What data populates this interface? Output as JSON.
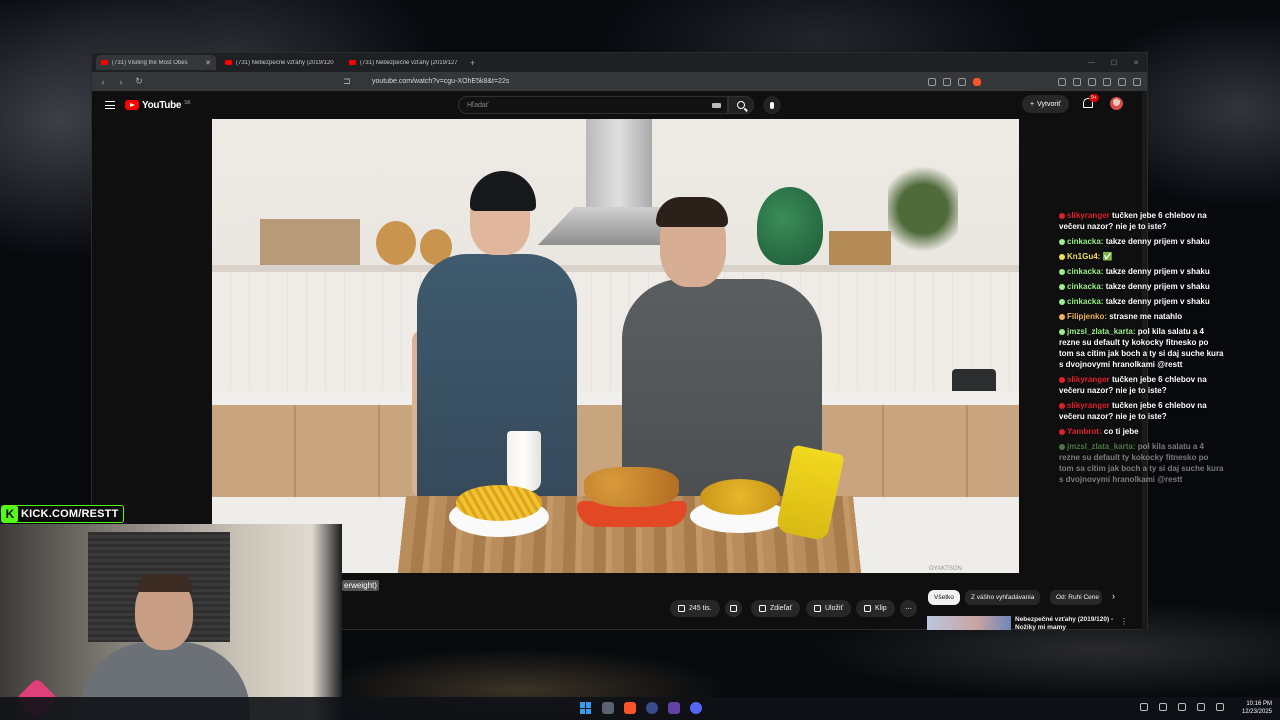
{
  "browser": {
    "tabs": [
      {
        "label": "(731) Visiting the Most Obes",
        "active": true
      },
      {
        "label": "(731) Nebezpečné vzťahy (2019/120",
        "active": false
      },
      {
        "label": "(731) Nebezpečné vzťahy (2019/127",
        "active": false
      }
    ],
    "url": "youtube.com/watch?v=cgu-XOhE5k8&t=22s"
  },
  "youtube": {
    "logo_text": "YouTube",
    "country_code": "SK",
    "search_placeholder": "Hľadať",
    "create_label": "Vytvoriť",
    "notification_count": "9+",
    "subtitle_chip": "erweight)",
    "like_count": "245 tis.",
    "share_label": "Zdieľať",
    "save_label": "Uložiť",
    "clip_label": "Klip",
    "filter_chips": [
      "Všetko",
      "Z vášho vyhľadávania",
      "Od: Ruhi Cene"
    ],
    "recommendation_title": "Nebezpečné vzťahy (2019/120) - Nožíky mi mamy",
    "video_watermark": "OYAKTSON"
  },
  "chat": {
    "messages": [
      {
        "user": "slikyranger",
        "color": "#e0202a",
        "text": "tučken jebe 6 chlebov na večeru nazor? nie je to iste?",
        "faded": false
      },
      {
        "user": "cinkacka:",
        "color": "#9af08a",
        "text": "takze denny prijem v shaku",
        "faded": false
      },
      {
        "user": "Kn1Gu4:",
        "color": "#f0e05a",
        "text": "✅",
        "faded": false
      },
      {
        "user": "cinkacka:",
        "color": "#9af08a",
        "text": "takze denny prijem v shaku",
        "faded": false
      },
      {
        "user": "cinkacka:",
        "color": "#9af08a",
        "text": "takze denny prijem v shaku",
        "faded": false
      },
      {
        "user": "cinkacka:",
        "color": "#9af08a",
        "text": "takze denny prijem v shaku",
        "faded": false
      },
      {
        "user": "Filipjenko:",
        "color": "#f0b45a",
        "text": "strasne me natahlo",
        "faded": false
      },
      {
        "user": "jmzsl_zlata_karta:",
        "color": "#9af08a",
        "text": "pol kila salatu a 4 rezne su default ty kokocky fitnesko po tom sa citim jak boch a ty si daj suche kura s dvojnovymi hranolkami @restt",
        "faded": false
      },
      {
        "user": "slikyranger",
        "color": "#e0202a",
        "text": "tučken jebe 6 chlebov na večeru nazor? nie je to iste?",
        "faded": false
      },
      {
        "user": "slikyranger",
        "color": "#e0202a",
        "text": "tučken jebe 6 chlebov na večeru nazor? nie je to iste?",
        "faded": false
      },
      {
        "user": "Yambrot:",
        "color": "#e0202a",
        "text": "co ti jebe",
        "faded": false
      },
      {
        "user": "jmzsl_zlata_karta:",
        "color": "#9af08a",
        "text": "pol kila salatu a 4 rezne su default ty kokocky fitnesko po tom sa citim jak boch a ty si daj suche kura s dvojnovymi hranolkami @restt",
        "faded": true
      }
    ]
  },
  "stream": {
    "kick_url": "KICK.COM/RESTT"
  },
  "taskbar": {
    "time": "10:16 PM",
    "date": "12/23/2025"
  }
}
